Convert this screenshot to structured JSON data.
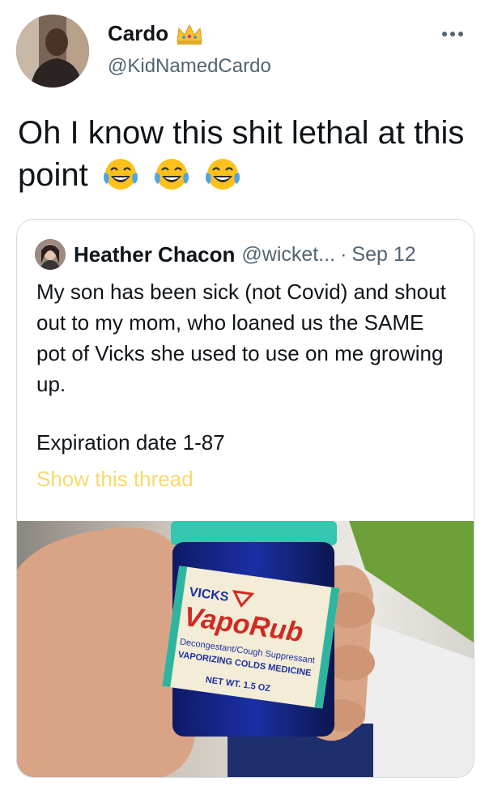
{
  "author": {
    "name": "Cardo",
    "handle": "@KidNamedCardo"
  },
  "tweet": {
    "text": "Oh I know this shit lethal at this point"
  },
  "icons": {
    "crown": "crown-icon",
    "more": "more-icon",
    "emoji": "tears-of-joy-emoji"
  },
  "quote": {
    "name": "Heather Chacon",
    "handle": "@wicket...",
    "separator": "·",
    "date": "Sep 12",
    "body": "My son has been sick (not Covid) and shout out to my mom, who loaned us the SAME pot of Vicks she used to use on me growing up.",
    "expiration": "Expiration date 1-87",
    "show_thread": "Show this thread",
    "show_thread_color": "#f7d96b"
  },
  "product_label": {
    "brand": "VICKS",
    "name": "VapoRub",
    "line1": "Decongestant/Cough Suppressant",
    "line2": "VAPORIZING COLDS MEDICINE",
    "net_wt": "NET WT. 1.5 OZ"
  }
}
